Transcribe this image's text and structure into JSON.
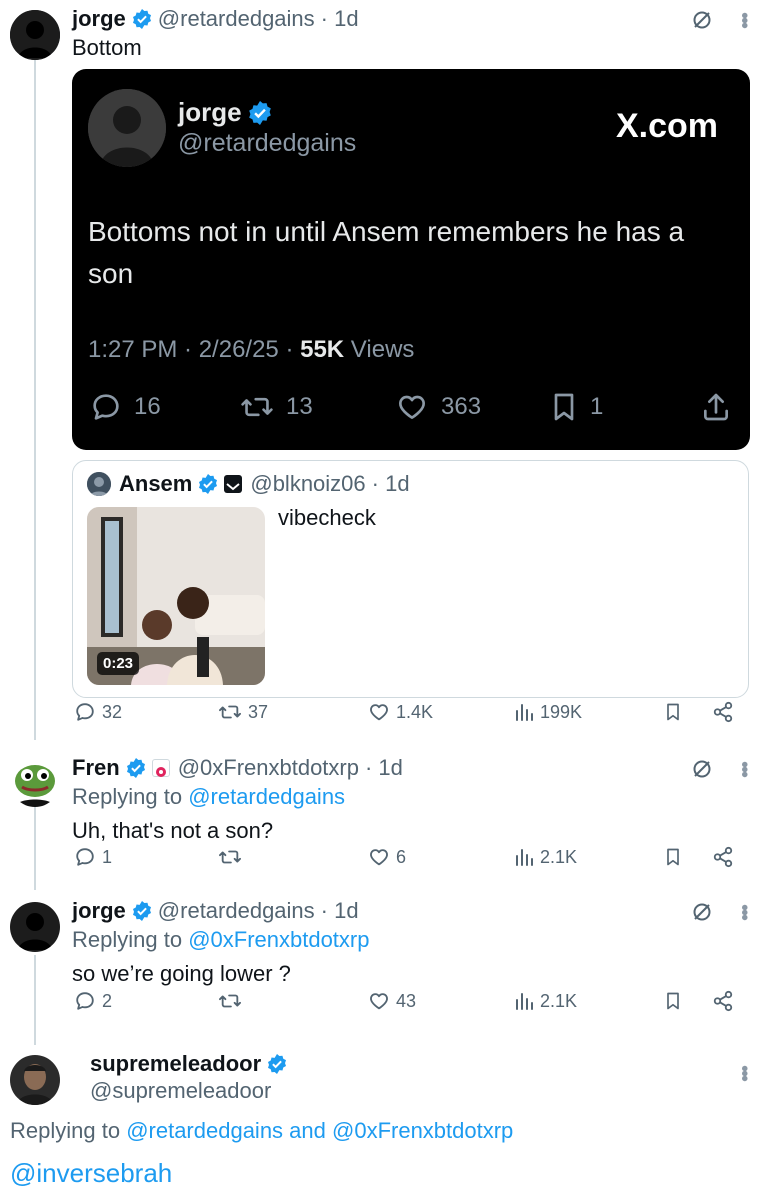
{
  "tweets": [
    {
      "name": "jorge",
      "handle": "@retardedgains",
      "time": "· 1d",
      "text": "Bottom",
      "embed": {
        "name": "jorge",
        "handle": "@retardedgains",
        "brand": "X.com",
        "text": "Bottoms not in until Ansem remembers he has a son",
        "meta_time": "1:27 PM · 2/26/25 · ",
        "meta_views_count": "55K",
        "meta_views_label": " Views",
        "replies": "16",
        "reposts": "13",
        "likes": "363",
        "bookmarks": "1"
      },
      "quote": {
        "name": "Ansem",
        "handle": "@blknoiz06",
        "time": "· 1d",
        "text": "vibecheck",
        "video_duration": "0:23"
      },
      "actions": {
        "replies": "32",
        "reposts": "37",
        "likes": "1.4K",
        "views": "199K"
      }
    },
    {
      "name": "Fren",
      "handle": "@0xFrenxbtdotxrp",
      "time": "· 1d",
      "replying_label": "Replying to ",
      "replying_to": "@retardedgains",
      "text": "Uh, that's not a son?",
      "actions": {
        "replies": "1",
        "reposts": "",
        "likes": "6",
        "views": "2.1K"
      }
    },
    {
      "name": "jorge",
      "handle": "@retardedgains",
      "time": "· 1d",
      "replying_label": "Replying to ",
      "replying_to": "@0xFrenxbtdotxrp",
      "text": "so we’re going lower ?",
      "actions": {
        "replies": "2",
        "reposts": "",
        "likes": "43",
        "views": "2.1K"
      }
    },
    {
      "name": "supremeleadoor",
      "handle": "@supremeleadoor",
      "replying_label": "Replying to ",
      "replying_to_1": "@retardedgains",
      "replying_and": " and ",
      "replying_to_2": "@0xFrenxbtdotxrp",
      "text": "@inversebrah"
    }
  ],
  "colors": {
    "accent": "#1d9bf0",
    "muted": "#536471",
    "verified": "#1d9bf0",
    "line": "#cfd9de"
  },
  "icons": [
    "verified-badge-icon",
    "grok-icon",
    "more-icon",
    "reply-icon",
    "repost-icon",
    "like-icon",
    "views-icon",
    "bookmark-icon",
    "share-icon",
    "upload-icon",
    "play-duration"
  ]
}
